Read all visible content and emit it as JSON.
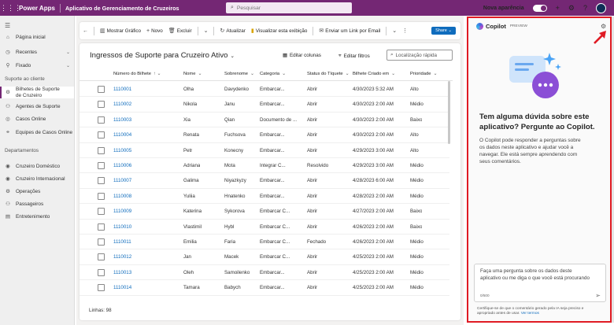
{
  "header": {
    "brand": "Power Apps",
    "app_title": "Aplicativo de Gerenciamento de Cruzeiros",
    "search_placeholder": "Pesquisar",
    "new_look_label": "Nova aparência"
  },
  "nav": {
    "items": [
      {
        "label": "Página inicial",
        "icon": "home-icon"
      },
      {
        "label": "Recentes",
        "icon": "clock-icon"
      },
      {
        "label": "Fixado",
        "icon": "pin-icon"
      }
    ],
    "section_support": "Suporte ao cliente",
    "support_items": [
      {
        "label": "Bilhetes de Suporte de Cruzeiro",
        "label_line2": "de Cruzeiro",
        "label_line1": "Bilhetes de Suporte"
      },
      {
        "label": "Agentes de Suporte"
      },
      {
        "label": "Casos Online"
      },
      {
        "label": "Equipes de Casos Online"
      }
    ],
    "section_departments": "Departamentos",
    "dept_items": [
      {
        "label": "Cruzeiro Doméstico"
      },
      {
        "label": "Cruzeiro Internacional"
      },
      {
        "label": "Operações"
      },
      {
        "label": "Passageiros"
      },
      {
        "label": "Entretenimento"
      }
    ]
  },
  "commandbar": {
    "show_chart": "Mostrar Gráfico",
    "new": "Novo",
    "delete": "Excluir",
    "refresh": "Atualizar",
    "visualize": "Visualizar esta exibição",
    "send_link": "Enviar um Link por Email",
    "share": "Share"
  },
  "grid": {
    "view_title": "Ingressos de Suporte para Cruzeiro Ativo",
    "edit_columns": "Editar colunas",
    "edit_filters": "Editar filtros",
    "quick_search": "Localização rápida",
    "columns": [
      "Número do Bilhete",
      "Nome",
      "Sobrenome",
      "Categoria",
      "Status do Tíquete",
      "Bilhete Criado em",
      "Prioridade"
    ],
    "rows": [
      [
        "1110001",
        "Olha",
        "Davydenko",
        "Embarcar...",
        "Abrir",
        "4/30/2023 5:32 AM",
        "Alto"
      ],
      [
        "1110002",
        "Nikola",
        "Janu",
        "Embarcar...",
        "Abrir",
        "4/30/2023 2:00 AM",
        "Médio"
      ],
      [
        "1110003",
        "Xia",
        "Qian",
        "Documento de ...",
        "Abrir",
        "4/30/2023 2:00 AM",
        "Baixo"
      ],
      [
        "1110004",
        "Renata",
        "Fuchsova",
        "Embarcar...",
        "Abrir",
        "4/30/2023 2:00 AM",
        "Alto"
      ],
      [
        "1110005",
        "Petr",
        "Konecny",
        "Embarcar...",
        "Abrir",
        "4/29/2023 3:00 AM",
        "Alto"
      ],
      [
        "1110006",
        "Adriana",
        "Mota",
        "Integrar C...",
        "Resolvido",
        "4/29/2023 3:00 AM",
        "Médio"
      ],
      [
        "1110007",
        "Galima",
        "Niyazkyzy",
        "Embarcar...",
        "Abrir",
        "4/28/2023 6:00 AM",
        "Médio"
      ],
      [
        "1110008",
        "Yuliia",
        "Hnatenko",
        "Embarcar...",
        "Abrir",
        "4/28/2023 2:00 AM",
        "Médio"
      ],
      [
        "1110009",
        "Katerina",
        "Sykorova",
        "Embarcar C...",
        "Abrir",
        "4/27/2023 2:00 AM",
        "Baixo"
      ],
      [
        "1110010",
        "Vlastimil",
        "Hybl",
        "Embarcar C...",
        "Abrir",
        "4/26/2023 2:00 AM",
        "Baixo"
      ],
      [
        "1110011",
        "Emilia",
        "Faria",
        "Embarcar C...",
        "Fechado",
        "4/26/2023 2:00 AM",
        "Médio"
      ],
      [
        "1110012",
        "Jan",
        "Macek",
        "Embarcar C...",
        "Abrir",
        "4/25/2023 2:00 AM",
        "Médio"
      ],
      [
        "1110013",
        "Oleh",
        "Samoilenko",
        "Embarcar...",
        "Abrir",
        "4/25/2023 2:00 AM",
        "Médio"
      ],
      [
        "1110014",
        "Tamara",
        "Babych",
        "Embarcar...",
        "Abrir",
        "4/25/2023 2:00 AM",
        "Médio"
      ]
    ],
    "footer": "Linhas: 98"
  },
  "copilot": {
    "name": "Copilot",
    "preview": "PREVIEW",
    "title": "Tem alguma dúvida sobre este aplicativo? Pergunte ao Copilot.",
    "body": "O Copilot pode responder a perguntas sobre os dados neste aplicativo e ajudar você a navegar. Ele está sempre aprendendo com seus comentários.",
    "input_placeholder": "Faça uma pergunta sobre os dados deste aplicativo ou me diga o que você está procurando",
    "counter": "0/500",
    "disclaimer": "Certifique-se de que o comentário gerado pela IA seja preciso e apropriado antes de usar.",
    "terms_link": "Ver termos"
  },
  "colors": {
    "header": "#742774",
    "link": "#0f6cbd",
    "highlight": "#e01b24"
  }
}
